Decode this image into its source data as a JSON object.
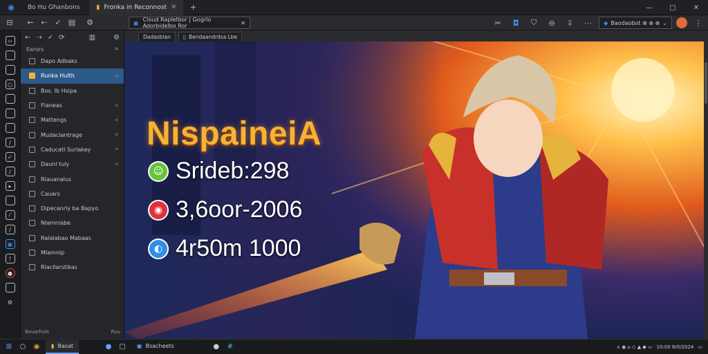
{
  "titlebar": {
    "app_short": "Bo Hu Ghanbons",
    "active_tab": "Fronka in Reconnost",
    "close": "✕",
    "controls": [
      "—",
      "□",
      "✕"
    ]
  },
  "toolbar": {
    "address": "Cloud Rapletbor | Gogrlo Adorbidelbo Ror",
    "ext_label": "Baodaobot ⊗ ⊗ ⊗",
    "ext_caret": "⌄"
  },
  "sidebar": {
    "header": "Earors",
    "items": [
      {
        "label": "Dapo Adbaks",
        "icon": "page-icon",
        "chevron": ""
      },
      {
        "label": "Runka Hulth",
        "icon": "star-icon",
        "chevron": "⌗"
      },
      {
        "label": "Bos. Ib Hsipa",
        "icon": "page-icon",
        "chevron": ""
      },
      {
        "label": "Flaneas",
        "icon": "page-icon",
        "chevron": "⌗"
      },
      {
        "label": "Mattengs",
        "icon": "page-icon",
        "chevron": "⌗"
      },
      {
        "label": "Mudaclantrage",
        "icon": "page-icon",
        "chevron": "⌗"
      },
      {
        "label": "Caducatl Surlakey",
        "icon": "page-icon",
        "chevron": "⌗"
      },
      {
        "label": "Daunl tuly",
        "icon": "page-icon",
        "chevron": "⌗"
      },
      {
        "label": "Rlauanalus",
        "icon": "bird-icon",
        "chevron": ""
      },
      {
        "label": "Cauars",
        "icon": "page-icon",
        "chevron": ""
      },
      {
        "label": "Dipecanrly ba Bapyo",
        "icon": "page-icon",
        "chevron": ""
      },
      {
        "label": "Nlamnlabe",
        "icon": "page-icon",
        "chevron": ""
      },
      {
        "label": "Ralalabao Mabaas",
        "icon": "page-icon",
        "chevron": ""
      },
      {
        "label": "Mlamnlp",
        "icon": "page-icon",
        "chevron": ""
      },
      {
        "label": "Rlacllarstikas",
        "icon": "page-icon",
        "chevron": ""
      }
    ],
    "footer_left": "Beuarhals",
    "footer_right": "Ruu"
  },
  "doc_tabs": [
    "Dadasblan",
    "Bendaandrdsa Lbe"
  ],
  "content": {
    "title": "NispaineiA",
    "stats": [
      {
        "value": "Srideb:298",
        "badge_color": "#69c23c",
        "badge_glyph": "☺"
      },
      {
        "value": "3,6oor-2006",
        "badge_color": "#e0303a",
        "badge_glyph": "◉"
      },
      {
        "value": "4r50m 1000",
        "badge_color": "#2f8fe6",
        "badge_glyph": "◐"
      }
    ]
  },
  "taskbar": {
    "apps": [
      "Basat",
      "Bsacheets"
    ],
    "tray": "∧ ◉ ⌂ ◇ ▲ ◆ ▭",
    "clock": "10:00 8/0/2024"
  },
  "colors": {
    "accent": "#3c8de8",
    "title": "#f6b233"
  }
}
